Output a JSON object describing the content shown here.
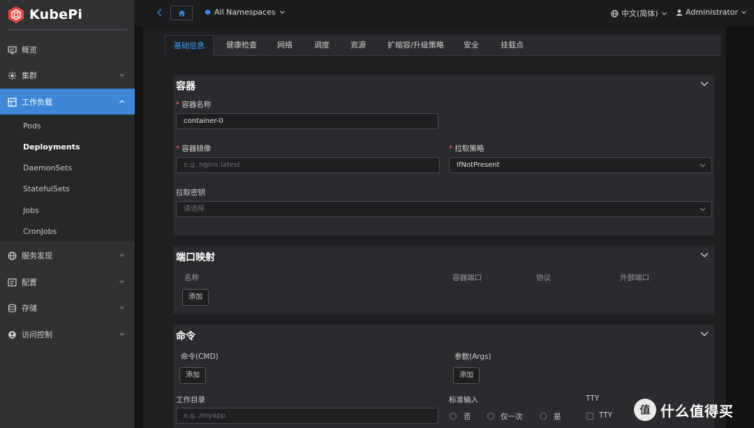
{
  "app": {
    "name": "KubePi"
  },
  "sidebar": {
    "items": [
      {
        "label": "概览",
        "icon": "monitor-icon"
      },
      {
        "label": "集群",
        "icon": "cluster-icon"
      },
      {
        "label": "工作负载",
        "icon": "workload-icon"
      },
      {
        "label": "服务发现",
        "icon": "globe-icon"
      },
      {
        "label": "配置",
        "icon": "config-icon"
      },
      {
        "label": "存储",
        "icon": "storage-icon"
      },
      {
        "label": "访问控制",
        "icon": "access-icon"
      }
    ],
    "subitems": [
      "Pods",
      "Deployments",
      "DaemonSets",
      "StatefulSets",
      "Jobs",
      "CronJobs"
    ]
  },
  "topbar": {
    "namespace": "All Namespaces",
    "language": "中文(简体)",
    "user": "Administrator"
  },
  "tabs": [
    "基础信息",
    "健康检查",
    "网络",
    "调度",
    "资源",
    "扩缩容/升级策略",
    "安全",
    "挂载点"
  ],
  "container": {
    "title": "容器",
    "name_label": "容器名称",
    "name_value": "container-0",
    "image_label": "容器镜像",
    "image_placeholder": "e.g. nginx:latest",
    "pull_policy_label": "拉取策略",
    "pull_policy_value": "IfNotPresent",
    "secret_label": "拉取密钥",
    "secret_placeholder": "请选择"
  },
  "ports": {
    "title": "端口映射",
    "columns": [
      "名称",
      "容器端口",
      "协议",
      "外部端口"
    ],
    "add_label": "添加"
  },
  "command": {
    "title": "命令",
    "cmd_label": "命令(CMD)",
    "args_label": "参数(Args)",
    "add_label": "添加",
    "workdir_label": "工作目录",
    "workdir_placeholder": "e.g. /myapp",
    "stdin_label": "标准输入",
    "stdin_options": [
      "否",
      "仅一次",
      "是"
    ],
    "tty_label": "TTY",
    "tty_option": "TTY"
  },
  "watermark": {
    "text": "什么值得买"
  },
  "colors": {
    "accent": "#3f86d6",
    "tab_active": "#3f9eff",
    "required": "#f56c6c"
  }
}
